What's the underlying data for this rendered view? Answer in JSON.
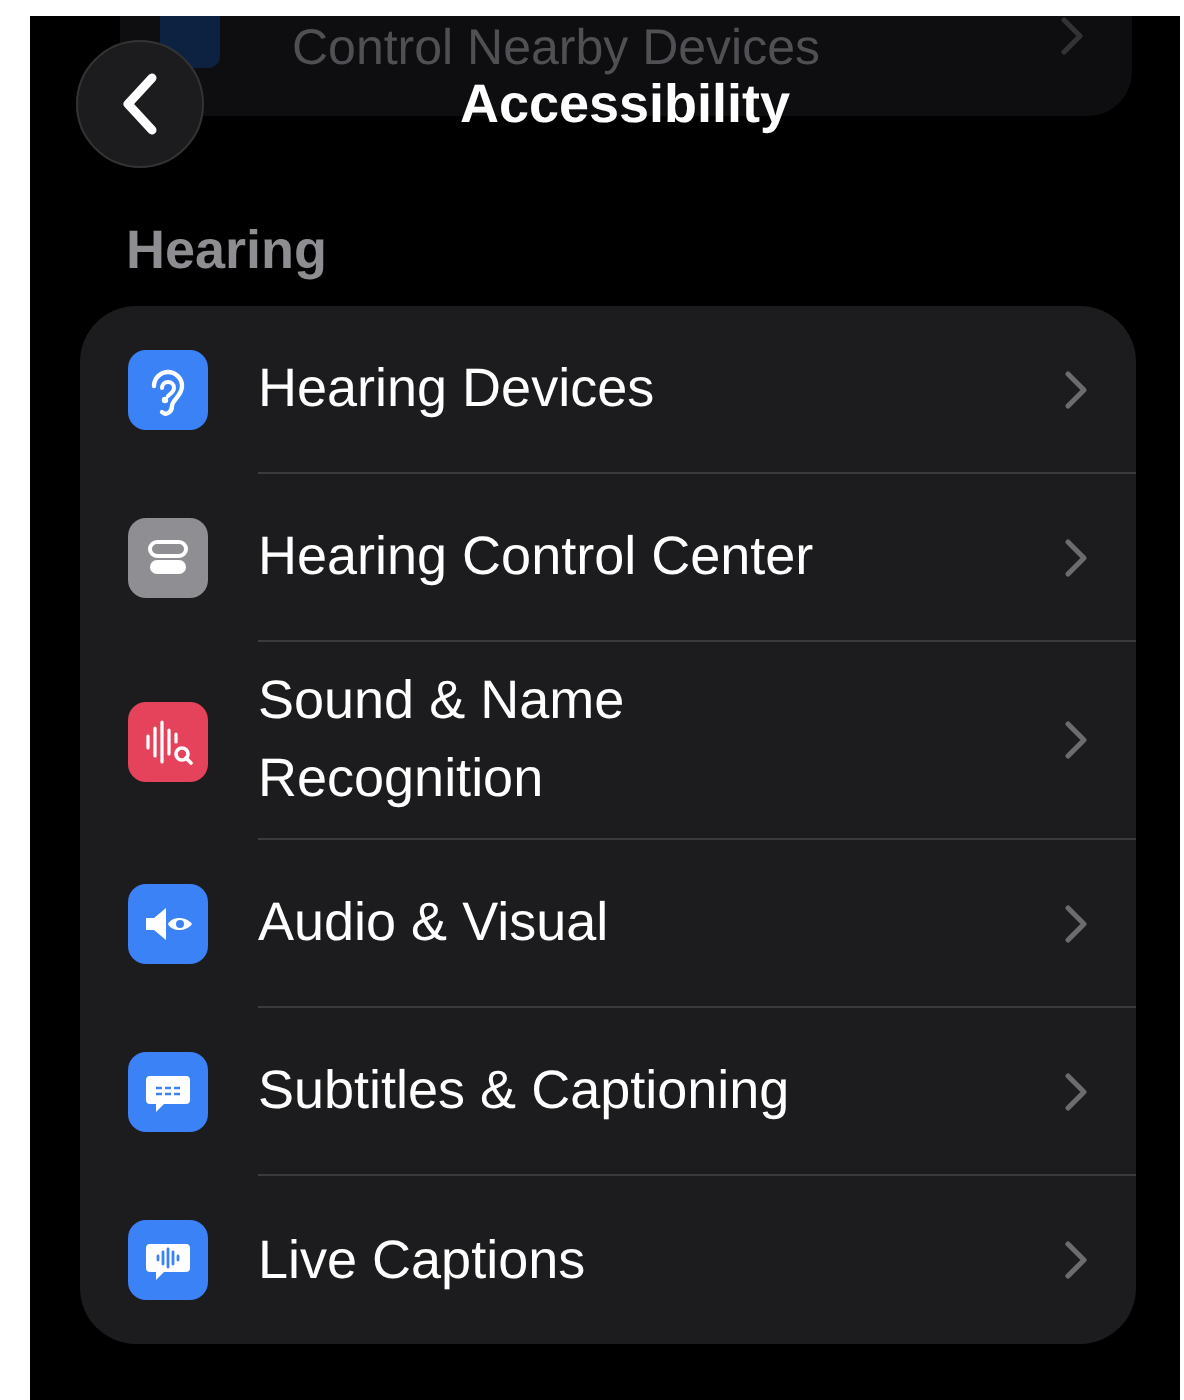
{
  "scrolled_row": {
    "title": "Control Nearby Devices"
  },
  "header": {
    "title": "Accessibility"
  },
  "section": {
    "title": "Hearing",
    "items": [
      {
        "title": "Hearing Devices",
        "kind": "ear",
        "color": "#3b82f6"
      },
      {
        "title": "Hearing Control Center",
        "kind": "toggles",
        "color": "#8e8e93"
      },
      {
        "title": "Sound & Name Recognition",
        "kind": "waveform",
        "color": "#e5435b"
      },
      {
        "title": "Audio & Visual",
        "kind": "speaker",
        "color": "#3b82f6"
      },
      {
        "title": "Subtitles & Captioning",
        "kind": "subtitles",
        "color": "#3b82f6"
      },
      {
        "title": "Live Captions",
        "kind": "captions",
        "color": "#3b82f6"
      }
    ]
  }
}
